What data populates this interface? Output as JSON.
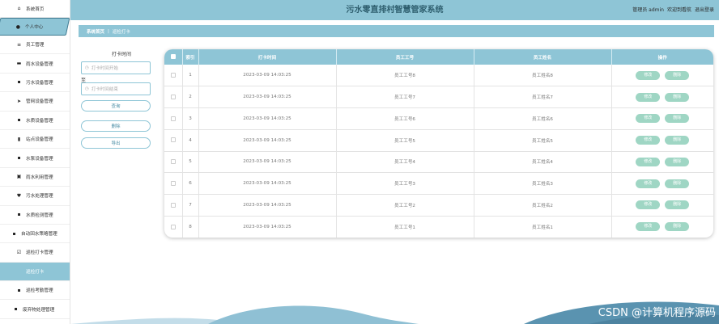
{
  "app": {
    "title": "污水零直排村智慧管家系统",
    "user_label": "管理员 admin",
    "welcome": "欢迎到看航",
    "logout": "退出登录"
  },
  "sidebar": {
    "items": [
      {
        "label": "系统首页",
        "icon": "home-icon",
        "glyph": "⌂"
      },
      {
        "label": "个人中心",
        "icon": "person-icon",
        "glyph": "●"
      },
      {
        "label": "员工管理",
        "icon": "list-icon",
        "glyph": "≡"
      },
      {
        "label": "雨水设备管理",
        "icon": "briefcase-icon",
        "glyph": "▬"
      },
      {
        "label": "污水设备管理",
        "icon": "grid-icon",
        "glyph": "▪"
      },
      {
        "label": "管网设备管理",
        "icon": "send-icon",
        "glyph": "➤"
      },
      {
        "label": "水质设备管理",
        "icon": "grid-icon",
        "glyph": "▪"
      },
      {
        "label": "站点设备管理",
        "icon": "chart-icon",
        "glyph": "▮"
      },
      {
        "label": "水泵设备管理",
        "icon": "grid-icon",
        "glyph": "▪"
      },
      {
        "label": "雨水利用管理",
        "icon": "trash-icon",
        "glyph": "▣"
      },
      {
        "label": "污水处理管理",
        "icon": "trophy-icon",
        "glyph": "♥"
      },
      {
        "label": "水质检测管理",
        "icon": "grid-icon",
        "glyph": "▪"
      },
      {
        "label": "自动回水策略管理",
        "icon": "grid-icon",
        "glyph": "▪"
      },
      {
        "label": "巡检打卡管理",
        "icon": "checkbox-icon",
        "glyph": "☑"
      },
      {
        "label": "巡检打卡",
        "icon": "",
        "glyph": ""
      },
      {
        "label": "巡检考勤管理",
        "icon": "grid-icon",
        "glyph": "▪"
      },
      {
        "label": "废弃物处理管理",
        "icon": "grid-icon",
        "glyph": "▪"
      }
    ]
  },
  "breadcrumb": {
    "home": "系统首页",
    "sep": "|",
    "current": "巡检打卡"
  },
  "search": {
    "label": "打卡时间",
    "start_placeholder": "打卡时间开始",
    "to": "至",
    "end_placeholder": "打卡时间结束",
    "query_button": "查询",
    "delete_button": "删除",
    "export_button": "导出"
  },
  "table": {
    "headers": {
      "index": "索引",
      "time": "打卡时间",
      "emp_no": "员工工号",
      "emp_name": "员工姓名",
      "ops": "操作"
    },
    "edit_label": "修改",
    "delete_label": "删除",
    "rows": [
      {
        "index": "1",
        "time": "2023-03-09 14:03:25",
        "emp_no": "员工工号8",
        "emp_name": "员工姓名8"
      },
      {
        "index": "2",
        "time": "2023-03-09 14:03:25",
        "emp_no": "员工工号7",
        "emp_name": "员工姓名7"
      },
      {
        "index": "3",
        "time": "2023-03-09 14:03:25",
        "emp_no": "员工工号6",
        "emp_name": "员工姓名6"
      },
      {
        "index": "4",
        "time": "2023-03-09 14:03:25",
        "emp_no": "员工工号5",
        "emp_name": "员工姓名5"
      },
      {
        "index": "5",
        "time": "2023-03-09 14:03:25",
        "emp_no": "员工工号4",
        "emp_name": "员工姓名4"
      },
      {
        "index": "6",
        "time": "2023-03-09 14:03:25",
        "emp_no": "员工工号3",
        "emp_name": "员工姓名3"
      },
      {
        "index": "7",
        "time": "2023-03-09 14:03:25",
        "emp_no": "员工工号2",
        "emp_name": "员工姓名2"
      },
      {
        "index": "8",
        "time": "2023-03-09 14:03:25",
        "emp_no": "员工工号1",
        "emp_name": "员工姓名1"
      }
    ]
  },
  "watermark": "CSDN @计算机程序源码",
  "colors": {
    "accent": "#8ec5d6",
    "button": "#9fd6c4",
    "wave_dark": "#5a93b0",
    "wave_light": "#a9cfdf"
  }
}
